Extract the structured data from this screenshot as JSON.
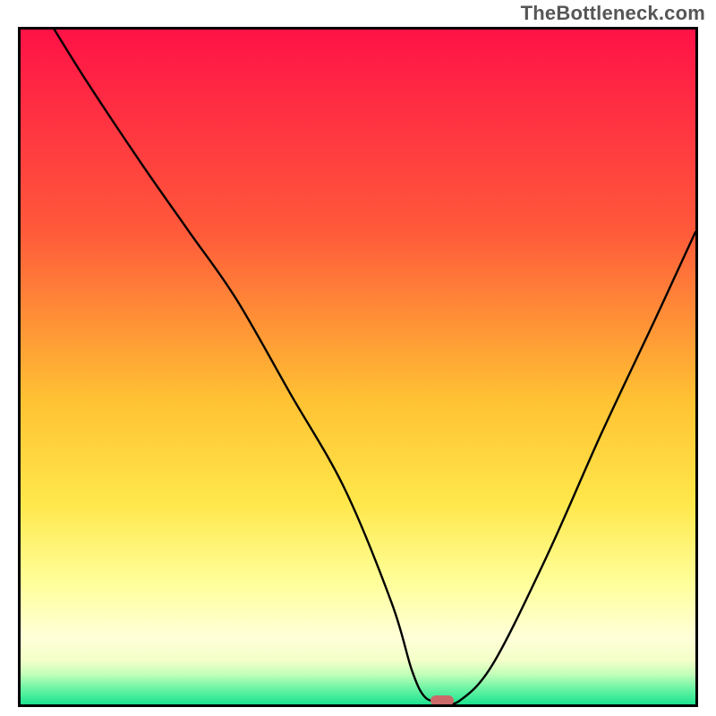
{
  "attribution": "TheBottleneck.com",
  "chart_data": {
    "type": "line",
    "title": "",
    "xlabel": "",
    "ylabel": "",
    "xlim": [
      0,
      100
    ],
    "ylim": [
      0,
      100
    ],
    "gradient_stops": [
      {
        "offset": 0,
        "color": "#ff1247"
      },
      {
        "offset": 0.3,
        "color": "#ff5a3a"
      },
      {
        "offset": 0.55,
        "color": "#ffc233"
      },
      {
        "offset": 0.7,
        "color": "#ffe74a"
      },
      {
        "offset": 0.82,
        "color": "#ffff9a"
      },
      {
        "offset": 0.9,
        "color": "#ffffd8"
      },
      {
        "offset": 0.935,
        "color": "#f3ffc8"
      },
      {
        "offset": 0.955,
        "color": "#c4ffba"
      },
      {
        "offset": 0.975,
        "color": "#71f5a6"
      },
      {
        "offset": 1.0,
        "color": "#1de38f"
      }
    ],
    "series": [
      {
        "name": "bottleneck-curve",
        "x": [
          5,
          10,
          18,
          25,
          32,
          40,
          48,
          55,
          58,
          60,
          62.5,
          65,
          70,
          78,
          86,
          94,
          100
        ],
        "y": [
          100,
          92,
          80,
          70,
          60,
          46,
          32,
          15,
          5,
          1,
          0.5,
          0.5,
          6,
          22,
          40,
          57,
          70
        ]
      }
    ],
    "marker": {
      "x": 62.5,
      "y": 0.5,
      "color": "#cc6a6a"
    },
    "annotations": []
  }
}
